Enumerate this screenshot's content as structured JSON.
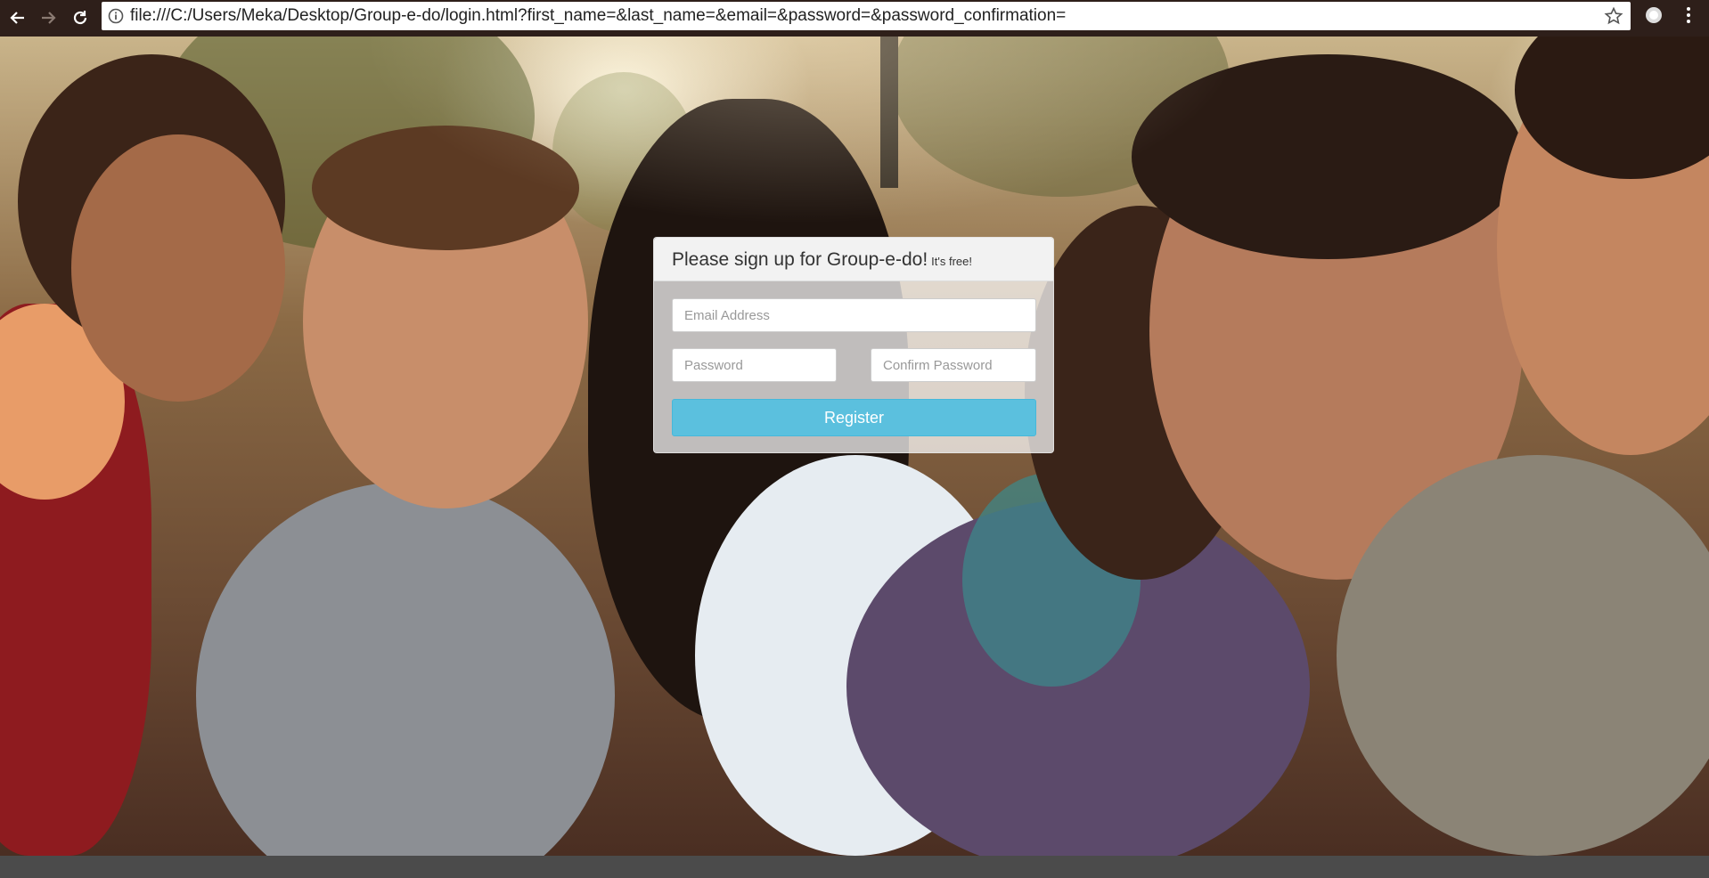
{
  "browser": {
    "url": "file:///C:/Users/Meka/Desktop/Group-e-do/login.html?first_name=&last_name=&email=&password=&password_confirmation="
  },
  "signup": {
    "title": "Please sign up for Group-e-do!",
    "subtitle": "It's free!",
    "email_placeholder": "Email Address",
    "password_placeholder": "Password",
    "confirm_placeholder": "Confirm Password",
    "register_label": "Register"
  },
  "colors": {
    "register_button": "#5bc0de",
    "chrome_bar": "#2e1f1a"
  }
}
